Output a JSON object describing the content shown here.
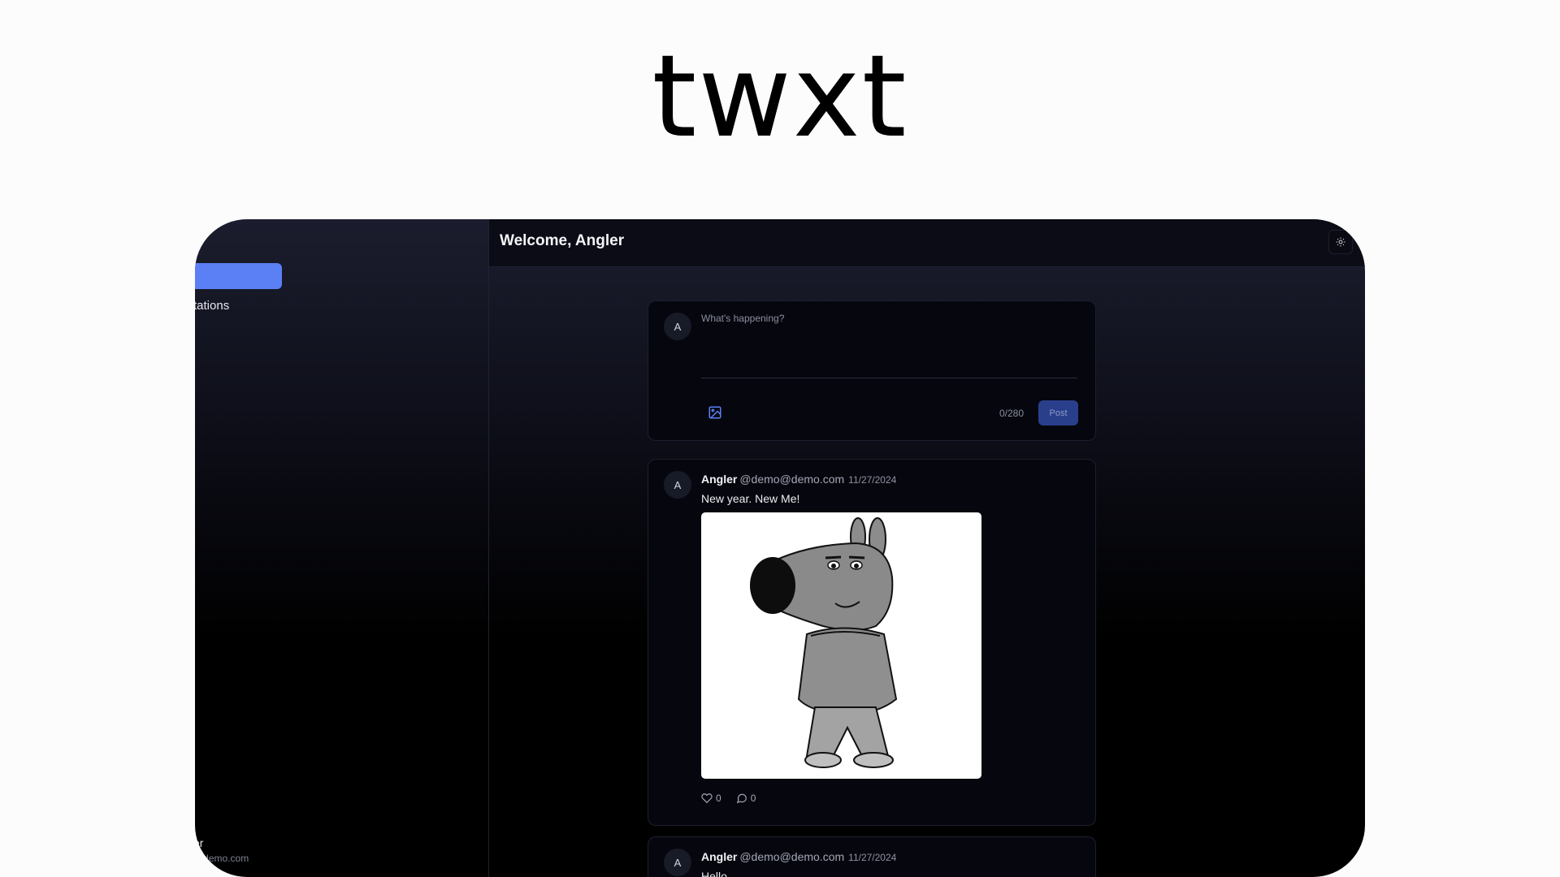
{
  "brand": {
    "title": "twxt"
  },
  "sidebar": {
    "items": [
      {
        "label": ""
      },
      {
        "label": "tations"
      }
    ],
    "user": {
      "name": "er",
      "email": "@demo.com"
    }
  },
  "header": {
    "title": "Welcome, Angler",
    "theme_icon": "sun-icon"
  },
  "composer": {
    "avatar_initial": "A",
    "placeholder": "What's happening?",
    "image_icon": "image-icon",
    "char_count": "0/280",
    "post_label": "Post"
  },
  "posts": [
    {
      "avatar_initial": "A",
      "author": "Angler",
      "handle": "@demo@demo.com",
      "date": "11/27/2024",
      "text": "New year. New Me!",
      "likes": "0",
      "comments": "0"
    },
    {
      "avatar_initial": "A",
      "author": "Angler",
      "handle": "@demo@demo.com",
      "date": "11/27/2024",
      "text": "Hello"
    }
  ],
  "colors": {
    "accent": "#5b7ff5",
    "post_button": "#2a3f8c",
    "card_bg": "#06070e"
  }
}
